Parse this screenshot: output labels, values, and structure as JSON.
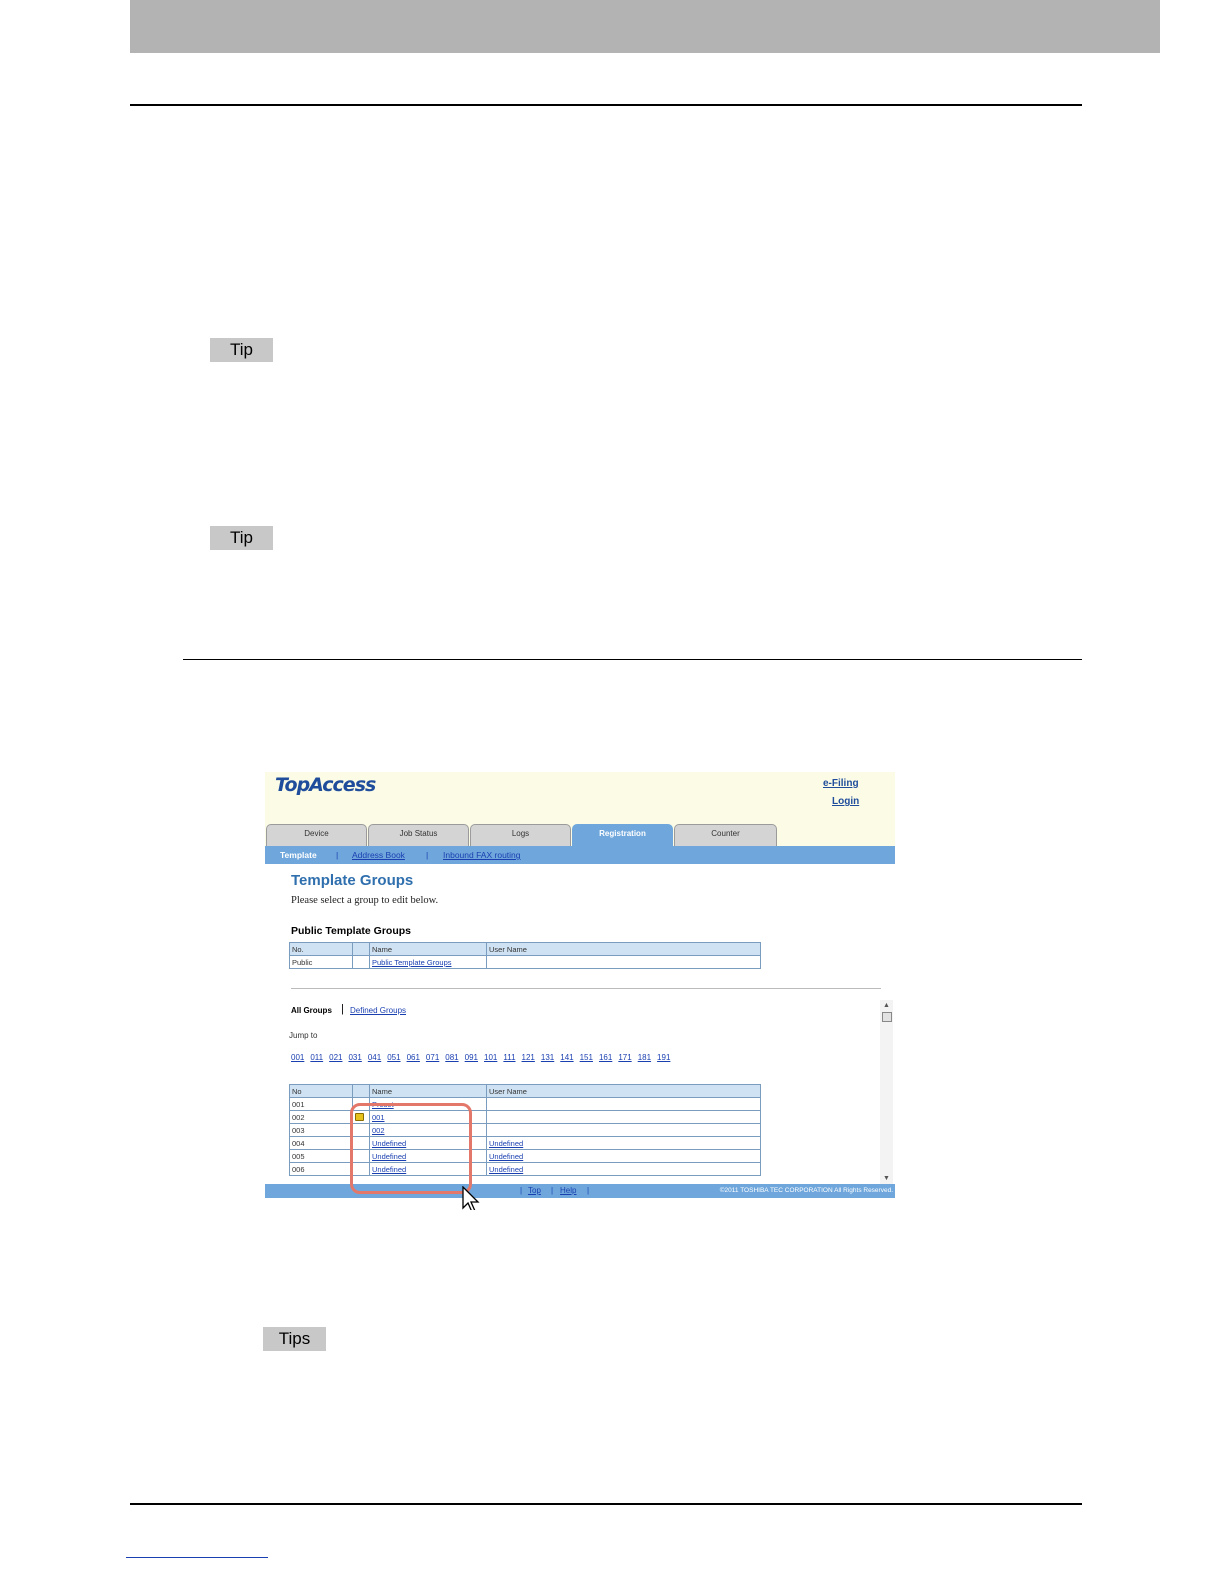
{
  "doc": {
    "tip_labels": [
      "Tip",
      "Tip",
      "Tips"
    ]
  },
  "screenshot": {
    "logo": "TopAccess",
    "top_links": [
      "e-Filing",
      "Login"
    ],
    "tabs": [
      "Device",
      "Job Status",
      "Logs",
      "Registration",
      "Counter"
    ],
    "active_tab": "Registration",
    "subnav": {
      "active": "Template",
      "links": [
        "Address Book",
        "Inbound FAX routing"
      ],
      "separator": "|"
    },
    "title": "Template Groups",
    "description": "Please select a group to edit below.",
    "public_section": {
      "heading": "Public Template Groups",
      "columns": [
        "No.",
        "",
        "Name",
        "User Name"
      ],
      "rows": [
        {
          "no": "Public",
          "name": "Public Template Groups",
          "user": ""
        }
      ]
    },
    "filter": {
      "all": "All Groups",
      "separator": "|",
      "defined": "Defined Groups"
    },
    "jump_label": "Jump to",
    "jump_links": [
      "001",
      "011",
      "021",
      "031",
      "041",
      "051",
      "061",
      "071",
      "081",
      "091",
      "101",
      "111",
      "121",
      "131",
      "141",
      "151",
      "161",
      "171",
      "181",
      "191"
    ],
    "groups": {
      "columns": [
        "No",
        "",
        "Name",
        "User Name"
      ],
      "rows": [
        {
          "no": "001",
          "lock": false,
          "name": "Preset",
          "user": ""
        },
        {
          "no": "002",
          "lock": true,
          "name": "001",
          "user": ""
        },
        {
          "no": "003",
          "lock": false,
          "name": "002",
          "user": ""
        },
        {
          "no": "004",
          "lock": false,
          "name": "Undefined",
          "user": "Undefined"
        },
        {
          "no": "005",
          "lock": false,
          "name": "Undefined",
          "user": "Undefined"
        },
        {
          "no": "006",
          "lock": false,
          "name": "Undefined",
          "user": "Undefined"
        }
      ]
    },
    "footer": {
      "links": [
        "Top",
        "Help"
      ],
      "separator": "|",
      "copyright": "©2011 TOSHIBA TEC CORPORATION All Rights Reserved."
    },
    "icons": {
      "lock": "lock-icon",
      "cursor": "mouse-pointer-icon"
    },
    "colors": {
      "nav_blue": "#6fa7dc",
      "title_blue": "#2f6fae",
      "header_bg": "#fbfbe6",
      "highlight": "#e3786a"
    }
  }
}
